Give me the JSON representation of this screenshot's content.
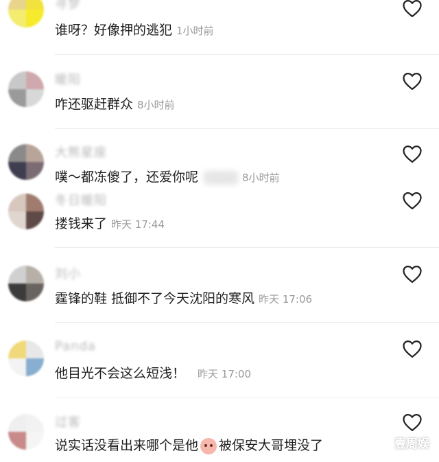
{
  "comments": [
    {
      "username": "寻梦",
      "text": "谁呀？好像押的逃犯",
      "time": "1小时前"
    },
    {
      "username": "暖阳",
      "text": "咋还驱赶群众",
      "time": "8小时前"
    },
    {
      "username": "大熊星座",
      "text": "噗～都冻傻了，还爱你呢",
      "time": "8小时前"
    },
    {
      "username": "冬日暖阳",
      "text": "搂钱来了",
      "time": "昨天 17:44"
    },
    {
      "username": "刘小",
      "text": "霆锋的鞋 抵御不了今天沈阳的寒风",
      "time": "昨天 17:06"
    },
    {
      "username": "Panda",
      "text": "他目光不会这么短浅！",
      "time": "昨天 17:00"
    },
    {
      "username": "过客",
      "text": "说实话没看出来哪个是他",
      "text2": "被保安大哥埋没了",
      "time": ""
    }
  ],
  "icons": {
    "like": "heart-outline-icon",
    "emoji": "peach-emoji-icon"
  },
  "watermark": "壹周娱",
  "colors": {
    "text": "#1f1f1f",
    "time": "#9a9a9a",
    "divider": "#ececec"
  }
}
